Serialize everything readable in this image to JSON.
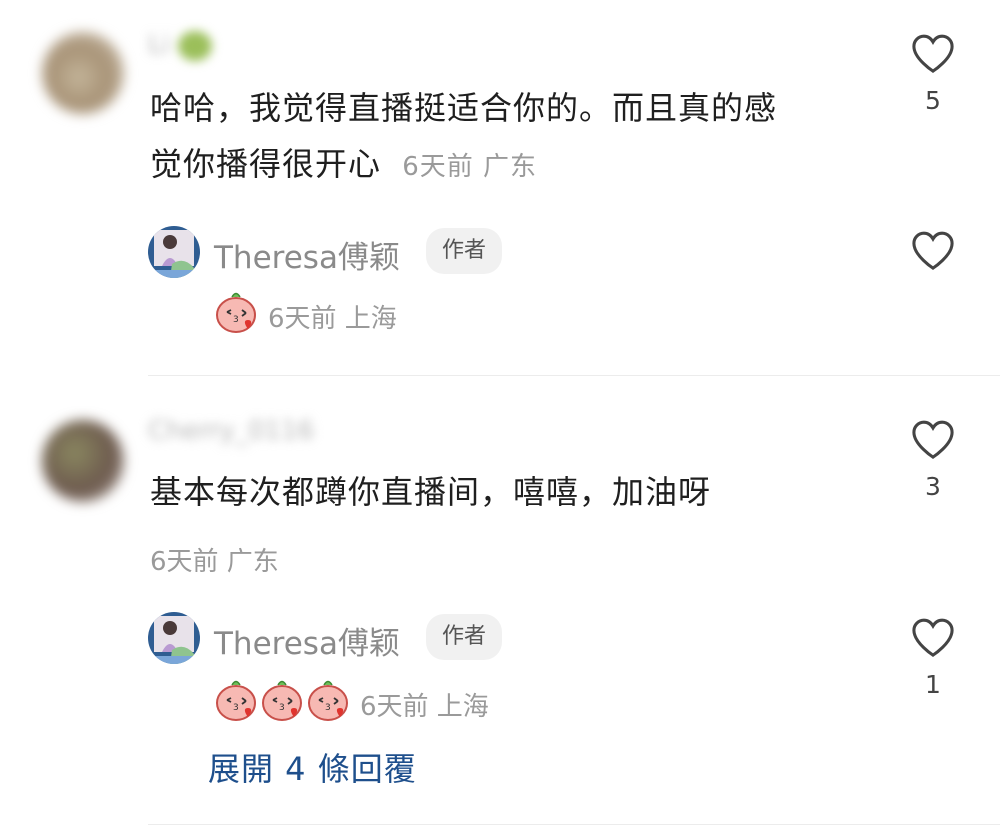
{
  "comments": [
    {
      "username": "Li",
      "text_line1": "哈哈，我觉得直播挺适合你的。而且真的感",
      "text_line2": "觉你播得很开心",
      "meta": "6天前 广东",
      "likes": "5",
      "reply": {
        "author": "Theresa傅颖",
        "badge": "作者",
        "meta": "6天前 上海",
        "emoji_count": 1,
        "likes": ""
      }
    },
    {
      "username": "Cherry_0116",
      "text": "基本每次都蹲你直播间，嘻嘻，加油呀",
      "meta": "6天前 广东",
      "likes": "3",
      "reply": {
        "author": "Theresa傅颖",
        "badge": "作者",
        "meta": "6天前 上海",
        "emoji_count": 3,
        "likes": "1"
      },
      "expand_replies": "展開 4 條回覆"
    }
  ],
  "colors": {
    "link": "#1e4f8c",
    "meta": "#9a9a9a",
    "badge_bg": "#f1f1f1"
  },
  "icons": [
    "heart-outline-icon",
    "kiss-peach-emoji"
  ]
}
